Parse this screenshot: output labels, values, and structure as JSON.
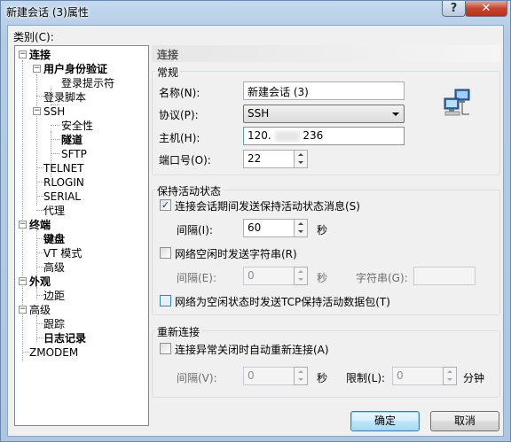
{
  "window": {
    "title": "新建会话 (3)属性",
    "help_glyph": "?",
    "close_glyph": "✕"
  },
  "category_label": "类别(C):",
  "tree": {
    "connection": "连接",
    "user_auth": "用户身份验证",
    "login_prompts": "登录提示符",
    "login_scripts": "登录脚本",
    "ssh": "SSH",
    "security": "安全性",
    "tunnel": "隧道",
    "sftp": "SFTP",
    "telnet": "TELNET",
    "rlogin": "RLOGIN",
    "serial": "SERIAL",
    "proxy": "代理",
    "terminal": "终端",
    "keyboard": "键盘",
    "vt_mode": "VT 模式",
    "advanced": "高级",
    "appearance": "外观",
    "margins": "边距",
    "advanced2": "高级",
    "trace": "跟踪",
    "logging": "日志记录",
    "zmodem": "ZMODEM"
  },
  "panel": {
    "header": "连接",
    "general": {
      "title": "常规",
      "name_label": "名称(N):",
      "name_value": "新建会话 (3)",
      "protocol_label": "协议(P):",
      "protocol_value": "SSH",
      "host_label": "主机(H):",
      "host_value_left": "120.",
      "host_value_right": "236",
      "port_label": "端口号(O):",
      "port_value": "22"
    },
    "keepalive": {
      "title": "保持活动状态",
      "send_keepalive_label": "连接会话期间发送保持活动状态消息(S)",
      "send_keepalive_checked": true,
      "interval_label": "间隔(I):",
      "interval_value": "60",
      "seconds": "秒",
      "idle_string_label": "网络空闲时发送字符串(R)",
      "idle_string_checked": false,
      "interval2_label": "间隔(E):",
      "interval2_value": "0",
      "seconds2": "秒",
      "string_label": "字符串(G):",
      "string_value": "",
      "tcp_keepalive_label": "网络为空闲状态时发送TCP保持活动数据包(T)",
      "tcp_keepalive_checked": false
    },
    "reconnect": {
      "title": "重新连接",
      "auto_reconnect_label": "连接异常关闭时自动重新连接(A)",
      "auto_reconnect_checked": false,
      "interval_label": "间隔(V):",
      "interval_value": "0",
      "seconds": "秒",
      "limit_label": "限制(L):",
      "limit_value": "0",
      "minutes": "分钟"
    }
  },
  "buttons": {
    "ok": "确定",
    "cancel": "取消"
  }
}
